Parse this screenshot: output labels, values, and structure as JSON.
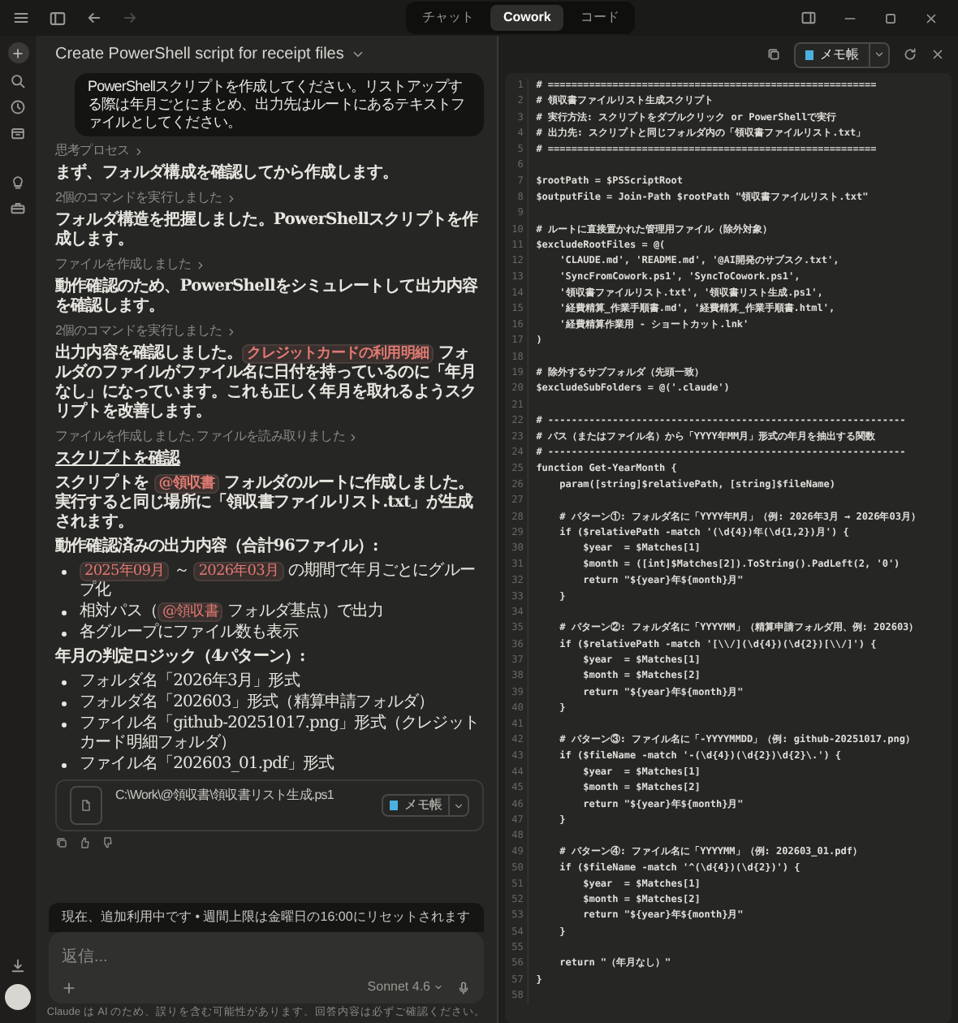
{
  "titlebar": {
    "nav": [
      {
        "kind": "back",
        "disabled": false
      },
      {
        "kind": "forward",
        "disabled": true
      }
    ],
    "tabs": [
      {
        "label": "チャット",
        "selected": false
      },
      {
        "label": "Cowork",
        "selected": true
      },
      {
        "label": "コード",
        "selected": false
      }
    ]
  },
  "conversation": {
    "title": "Create PowerShell script for receipt files",
    "user_message": "PowerShellスクリプトを作成してください。リストアップする際は年月ごとにまとめ、出力先はルートにあるテキストファイルとしてください。",
    "steps": [
      {
        "label": "思考プロセス",
        "text": [
          {
            "text": "まず、フォルダ構成を確認してから作成します。"
          }
        ]
      },
      {
        "label": "2個のコマンドを実行しました",
        "text": [
          {
            "text": "フォルダ構造を把握しました。PowerShellスクリプトを作成します。"
          }
        ]
      },
      {
        "label": "ファイルを作成しました",
        "text": [
          {
            "text": "動作確認のため、PowerShellをシミュレートして出力内容を確認します。"
          }
        ]
      },
      {
        "label": "2個のコマンドを実行しました",
        "text": [
          {
            "text": "出力内容を確認しました。"
          },
          {
            "text": "クレジットカードの利用明細",
            "kind": "code"
          },
          {
            "text": " フォルダのファイルがファイル名に日付を持っているのに「年月なし」になっています。これも正しく年月を取れるようスクリプトを改善します。"
          }
        ]
      },
      {
        "label": "ファイルを作成しました, ファイルを読み取りました"
      }
    ],
    "link": "スクリプトを確認",
    "summary": [
      {
        "text": "スクリプトを "
      },
      {
        "text": "@領収書",
        "kind": "code"
      },
      {
        "text": " フォルダのルートに作成しました。実行すると同じ場所に「領収書ファイルリスト.txt」が生成されます。"
      }
    ],
    "sections": [
      {
        "heading": "動作確認済みの出力内容（合計96ファイル）:",
        "bullets": [
          [
            {
              "text": "2025年09月",
              "kind": "code"
            },
            {
              "text": " ～ "
            },
            {
              "text": "2026年03月",
              "kind": "code"
            },
            {
              "text": " の期間で年月ごとにグループ化"
            }
          ],
          [
            {
              "text": "相対パス（"
            },
            {
              "text": "@領収書",
              "kind": "code"
            },
            {
              "text": " フォルダ基点）で出力"
            }
          ],
          [
            {
              "text": "各グループにファイル数も表示"
            }
          ]
        ]
      },
      {
        "heading": "年月の判定ロジック（4パターン）:",
        "bullets": [
          [
            {
              "text": "フォルダ名「2026年3月」形式"
            }
          ],
          [
            {
              "text": "フォルダ名「202603」形式（精算申請フォルダ）"
            }
          ],
          [
            {
              "text": "ファイル名「github-20251017.png」形式（クレジットカード明細フォルダ）"
            }
          ],
          [
            {
              "text": "ファイル名「202603_01.pdf」形式"
            }
          ]
        ]
      }
    ],
    "file_card": {
      "path": "C:\\Work\\@領収書\\領収書リスト生成.ps1",
      "open_button": "メモ帳"
    },
    "banner": {
      "text": "現在、追加利用中です • 週間上限は金曜日の16:00にリセットされます"
    },
    "composer": {
      "placeholder": "返信...",
      "model": "Sonnet 4.6"
    },
    "disclaimer": "Claude は AI のため、誤りを含む可能性があります。回答内容は必ずご確認ください。"
  },
  "editor": {
    "open_button": "メモ帳",
    "lines": [
      {
        "number": "1",
        "text": "# ========================================================"
      },
      {
        "number": "2",
        "text": "# 領収書ファイルリスト生成スクリプト"
      },
      {
        "number": "3",
        "text": "# 実行方法: スクリプトをダブルクリック or PowerShellで実行"
      },
      {
        "number": "4",
        "text": "# 出力先: スクリプトと同じフォルダ内の「領収書ファイルリスト.txt」"
      },
      {
        "number": "5",
        "text": "# ========================================================"
      },
      {
        "number": "6"
      },
      {
        "number": "7",
        "text": "$rootPath = $PSScriptRoot"
      },
      {
        "number": "8",
        "text": "$outputFile = Join-Path $rootPath \"領収書ファイルリスト.txt\""
      },
      {
        "number": "9"
      },
      {
        "number": "10",
        "text": "# ルートに直接置かれた管理用ファイル（除外対象）"
      },
      {
        "number": "11",
        "text": "$excludeRootFiles = @("
      },
      {
        "number": "12",
        "text": "    'CLAUDE.md', 'README.md', '@AI開発のサブスク.txt',"
      },
      {
        "number": "13",
        "text": "    'SyncFromCowork.ps1', 'SyncToCowork.ps1',"
      },
      {
        "number": "14",
        "text": "    '領収書ファイルリスト.txt', '領収書リスト生成.ps1',"
      },
      {
        "number": "15",
        "text": "    '経費精算_作業手順書.md', '経費精算_作業手順書.html',"
      },
      {
        "number": "16",
        "text": "    '経費精算作業用 - ショートカット.lnk'"
      },
      {
        "number": "17",
        "text": ")"
      },
      {
        "number": "18"
      },
      {
        "number": "19",
        "text": "# 除外するサブフォルダ（先頭一致）"
      },
      {
        "number": "20",
        "text": "$excludeSubFolders = @('.claude')"
      },
      {
        "number": "21"
      },
      {
        "number": "22",
        "text": "# -------------------------------------------------------------"
      },
      {
        "number": "23",
        "text": "# パス（またはファイル名）から「YYYY年MM月」形式の年月を抽出する関数"
      },
      {
        "number": "24",
        "text": "# -------------------------------------------------------------"
      },
      {
        "number": "25",
        "text": "function Get-YearMonth {"
      },
      {
        "number": "26",
        "text": "    param([string]$relativePath, [string]$fileName)"
      },
      {
        "number": "27"
      },
      {
        "number": "28",
        "text": "    # パターン①: フォルダ名に「YYYY年M月」（例: 2026年3月 → 2026年03月）"
      },
      {
        "number": "29",
        "text": "    if ($relativePath -match '(\\d{4})年(\\d{1,2})月') {"
      },
      {
        "number": "30",
        "text": "        $year  = $Matches[1]"
      },
      {
        "number": "31",
        "text": "        $month = ([int]$Matches[2]).ToString().PadLeft(2, '0')"
      },
      {
        "number": "32",
        "text": "        return \"${year}年${month}月\""
      },
      {
        "number": "33",
        "text": "    }"
      },
      {
        "number": "34"
      },
      {
        "number": "35",
        "text": "    # パターン②: フォルダ名に「YYYYMM」（精算申請フォルダ用、例: 202603）"
      },
      {
        "number": "36",
        "text": "    if ($relativePath -match '[\\\\/](\\d{4})(\\d{2})[\\\\/]') {"
      },
      {
        "number": "37",
        "text": "        $year  = $Matches[1]"
      },
      {
        "number": "38",
        "text": "        $month = $Matches[2]"
      },
      {
        "number": "39",
        "text": "        return \"${year}年${month}月\""
      },
      {
        "number": "40",
        "text": "    }"
      },
      {
        "number": "41"
      },
      {
        "number": "42",
        "text": "    # パターン③: ファイル名に「-YYYYMMDD」（例: github-20251017.png）"
      },
      {
        "number": "43",
        "text": "    if ($fileName -match '-(\\d{4})(\\d{2})\\d{2}\\.') {"
      },
      {
        "number": "44",
        "text": "        $year  = $Matches[1]"
      },
      {
        "number": "45",
        "text": "        $month = $Matches[2]"
      },
      {
        "number": "46",
        "text": "        return \"${year}年${month}月\""
      },
      {
        "number": "47",
        "text": "    }"
      },
      {
        "number": "48"
      },
      {
        "number": "49",
        "text": "    # パターン④: ファイル名に「YYYYMM」（例: 202603_01.pdf）"
      },
      {
        "number": "50",
        "text": "    if ($fileName -match '^(\\d{4})(\\d{2})') {"
      },
      {
        "number": "51",
        "text": "        $year  = $Matches[1]"
      },
      {
        "number": "52",
        "text": "        $month = $Matches[2]"
      },
      {
        "number": "53",
        "text": "        return \"${year}年${month}月\""
      },
      {
        "number": "54",
        "text": "    }"
      },
      {
        "number": "55"
      },
      {
        "number": "56",
        "text": "    return \"（年月なし）\""
      },
      {
        "number": "57",
        "text": "}"
      },
      {
        "number": "58"
      }
    ]
  }
}
